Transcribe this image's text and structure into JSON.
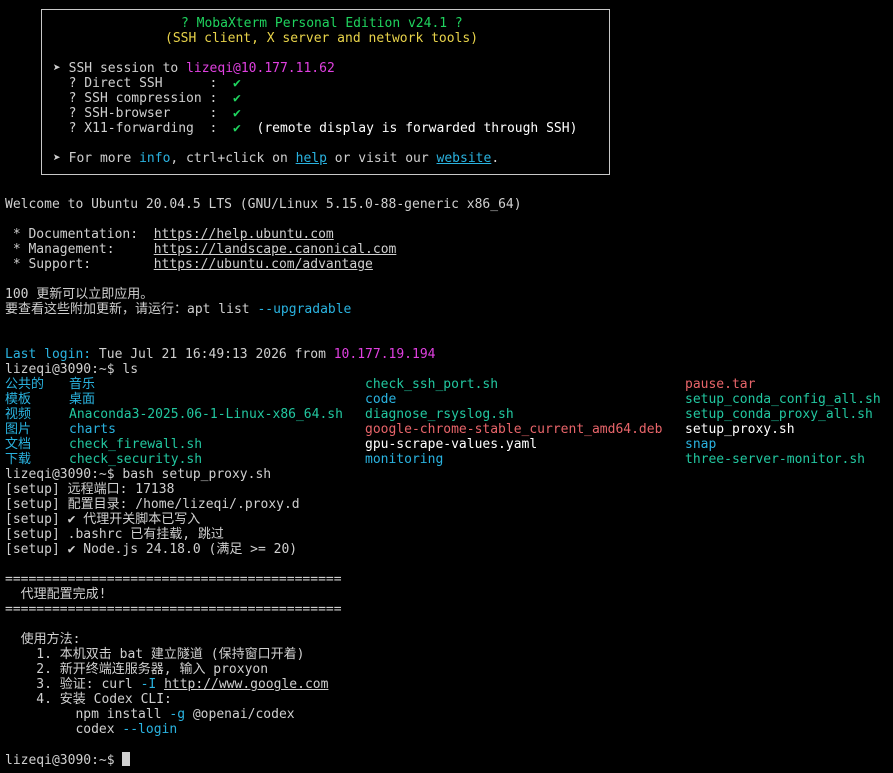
{
  "banner": {
    "title": "? MobaXterm Personal Edition v24.1 ?",
    "subtitle": "(SSH client, X server and network tools)",
    "ssh_prefix": "➤ SSH session to ",
    "ssh_target": "lizeqi@10.177.11.62",
    "rows": [
      {
        "label": "  ? Direct SSH      :  ",
        "check": "✔",
        "note": ""
      },
      {
        "label": "  ? SSH compression :  ",
        "check": "✔",
        "note": ""
      },
      {
        "label": "  ? SSH-browser     :  ",
        "check": "✔",
        "note": ""
      },
      {
        "label": "  ? X11-forwarding  :  ",
        "check": "✔",
        "note": "  (remote display is forwarded through SSH)"
      }
    ],
    "more_prefix": "➤ For more ",
    "more_info": "info",
    "more_mid": ", ctrl+click on ",
    "more_help": "help",
    "more_mid2": " or visit our ",
    "more_website": "website",
    "more_end": "."
  },
  "welcome": "Welcome to Ubuntu 20.04.5 LTS (GNU/Linux 5.15.0-88-generic x86_64)",
  "links": [
    {
      "label": " * Documentation:  ",
      "url": "https://help.ubuntu.com"
    },
    {
      "label": " * Management:     ",
      "url": "https://landscape.canonical.com"
    },
    {
      "label": " * Support:        ",
      "url": "https://ubuntu.com/advantage"
    }
  ],
  "updates_line1": "100 更新可以立即应用。",
  "updates_line2_a": "要查看这些附加更新，请运行：apt list ",
  "updates_line2_b": "--upgradable",
  "last_login_label": "Last login:",
  "last_login_date": " Tue Jul 21 16:49:13 2026 from ",
  "last_login_ip": "10.177.19.194",
  "prompt": "lizeqi@3090:~$ ",
  "cmd_ls": "ls",
  "ls_col1": [
    "公共的",
    "模板",
    "视频",
    "图片",
    "文档",
    "下载"
  ],
  "ls_col2": [
    "音乐",
    "桌面",
    "Anaconda3-2025.06-1-Linux-x86_64.sh",
    "charts",
    "check_firewall.sh",
    "check_security.sh"
  ],
  "ls_col3": [
    "check_ssh_port.sh",
    "code",
    "diagnose_rsyslog.sh",
    "google-chrome-stable_current_amd64.deb",
    "gpu-scrape-values.yaml",
    "monitoring"
  ],
  "ls_col4": [
    "pause.tar",
    "setup_conda_config_all.sh",
    "setup_conda_proxy_all.sh",
    "setup_proxy.sh",
    "snap",
    "three-server-monitor.sh"
  ],
  "cmd_bash": "bash setup_proxy.sh",
  "setup_lines": [
    "[setup] 远程端口: 17138",
    "[setup] 配置目录: /home/lizeqi/.proxy.d",
    "[setup] ✔ 代理开关脚本已写入",
    "[setup] .bashrc 已有挂载, 跳过",
    "[setup] ✔ Node.js 24.18.0 (满足 >= 20)"
  ],
  "separator": "===========================================",
  "done_text": "  代理配置完成!",
  "usage_title": "  使用方法:",
  "usage_1": "    1. 本机双击 bat 建立隧道 (保持窗口开着)",
  "usage_2": "    2. 新开终端连服务器, 输入 proxyon",
  "usage_3_a": "    3. 验证: curl ",
  "usage_3_flag": "-I",
  "usage_3_sp": " ",
  "usage_3_url": "http://www.google.com",
  "usage_4": "    4. 安装 Codex CLI:",
  "usage_4a_a": "         npm install ",
  "usage_4a_flag": "-g",
  "usage_4a_b": " @openai/codex",
  "usage_4b_a": "         codex ",
  "usage_4b_flag": "--login"
}
